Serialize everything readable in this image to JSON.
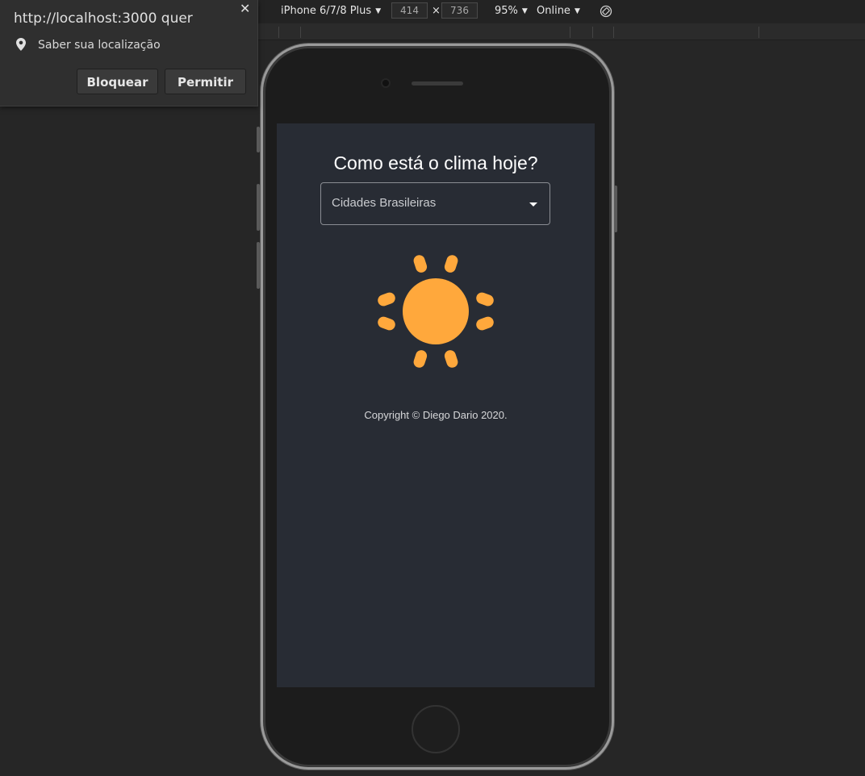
{
  "devtools": {
    "device": "iPhone 6/7/8 Plus",
    "width": "414",
    "height": "736",
    "dim_separator": "×",
    "zoom": "95%",
    "network": "Online",
    "caret": "▼"
  },
  "permission_popup": {
    "title": "http://localhost:3000 quer",
    "close": "✕",
    "request": "Saber sua localização",
    "block_label": "Bloquear",
    "allow_label": "Permitir"
  },
  "app": {
    "title": "Como está o clima hoje?",
    "select": {
      "value": "Cidades Brasileiras"
    },
    "weather_icon": "sun-icon",
    "sun_color": "#ffa83c",
    "background": "#282c34",
    "copyright": "Copyright © Diego Dario 2020."
  }
}
